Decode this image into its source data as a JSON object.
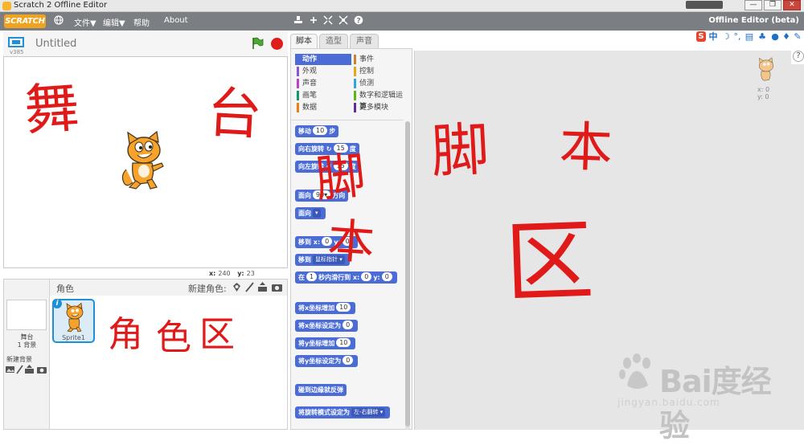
{
  "window": {
    "title": "Scratch 2 Offline Editor",
    "minimize": "—",
    "restore": "❐",
    "close": "✕"
  },
  "menubar": {
    "logo": "SCRATCH",
    "file": "文件▼",
    "edit": "编辑▼",
    "help": "帮助",
    "about": "About",
    "edition": "Offline Editor (beta)",
    "icons": [
      "globe-icon",
      "duplicate-stamp-icon",
      "delete-cut-icon",
      "grow-icon",
      "shrink-icon",
      "help-icon"
    ]
  },
  "stage": {
    "version": "v385",
    "project_name": "Untitled",
    "mouse_x_label": "x:",
    "mouse_x": "240",
    "mouse_y_label": "y:",
    "mouse_y": "23"
  },
  "sprites": {
    "title": "角色",
    "new_sprite": "新建角色:",
    "stage_label": "舞台",
    "stage_backdrops": "1 背景",
    "new_backdrop": "新建背景",
    "sprite_name": "Sprite1",
    "info_badge": "i"
  },
  "tabs": [
    "脚本",
    "造型",
    "声音"
  ],
  "categories": [
    {
      "label": "动作",
      "color": "#4a6cd4"
    },
    {
      "label": "事件",
      "color": "#c88330"
    },
    {
      "label": "外观",
      "color": "#8a55d7"
    },
    {
      "label": "控制",
      "color": "#e1a91a"
    },
    {
      "label": "声音",
      "color": "#bb42c3"
    },
    {
      "label": "侦测",
      "color": "#2ca5e2"
    },
    {
      "label": "画笔",
      "color": "#0e9a6c"
    },
    {
      "label": "数字和逻辑运算",
      "color": "#5cb712"
    },
    {
      "label": "数据",
      "color": "#ee7d16"
    },
    {
      "label": "更多模块",
      "color": "#632d99"
    }
  ],
  "blocks": {
    "move": [
      "移动",
      "10",
      "步"
    ],
    "turn_right": [
      "向右旋转",
      "15",
      "度"
    ],
    "turn_left": [
      "向左旋转",
      "15",
      "度"
    ],
    "point_dir": [
      "面向",
      "90▾",
      "方向"
    ],
    "point_towards": [
      "面向",
      "▾"
    ],
    "goto_xy": [
      "移到 x:",
      "0",
      "y:",
      "0"
    ],
    "goto": [
      "移到",
      "鼠标指针 ▾"
    ],
    "glide": [
      "在",
      "1",
      "秒内滑行到 x:",
      "0",
      "y:",
      "0"
    ],
    "change_x": [
      "将x坐标增加",
      "10"
    ],
    "set_x": [
      "将x坐标设定为",
      "0"
    ],
    "change_y": [
      "将y坐标增加",
      "10"
    ],
    "set_y": [
      "将y坐标设定为",
      "0"
    ],
    "bounce": "碰到边缘就反弹",
    "rotation_style": [
      "将旋转模式设定为",
      "左-右翻转 ▾"
    ]
  },
  "script_area": {
    "sprite_x": "x: 0",
    "sprite_y": "y: 0",
    "help": "?"
  },
  "annotations": {
    "stage_zone": [
      "舞",
      "台"
    ],
    "script_zone": [
      "脚",
      "本",
      "区"
    ],
    "palette_overlay": [
      "脚",
      "本"
    ],
    "sprite_zone": [
      "角",
      "色",
      "区"
    ]
  },
  "watermark": {
    "text": "Bai度经验",
    "url": "jingyan.baidu.com"
  },
  "colors": {
    "menubar": "#7b7e82",
    "motion": "#4a6cd4",
    "accent": "#1f8fd6",
    "ink": "#e01919"
  }
}
